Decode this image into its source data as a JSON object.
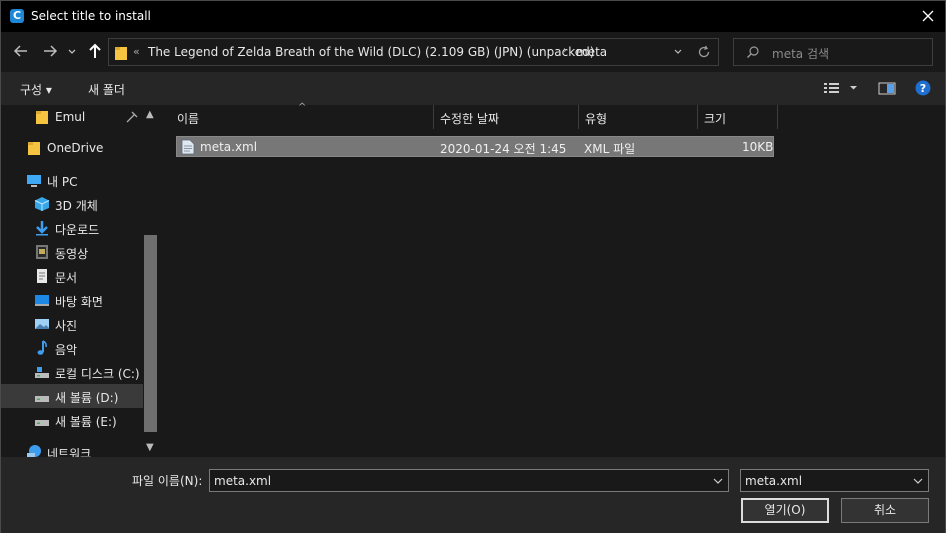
{
  "window": {
    "title": "Select title to install",
    "app_icon_letter": "C"
  },
  "nav": {
    "back_icon": "arrow-left-icon",
    "forward_icon": "arrow-right-icon",
    "recent_icon": "chevron-down-icon",
    "up_icon": "arrow-up-icon",
    "address": {
      "overflow": "«",
      "path": "The Legend of Zelda Breath of the Wild (DLC) (2.109 GB) (JPN) (unpacked)",
      "separator": "›",
      "current": "meta"
    },
    "search_placeholder": "meta 검색"
  },
  "toolbar": {
    "organize_label": "구성 ▾",
    "new_folder_label": "새 폴더",
    "help_label": "?"
  },
  "sidebar": {
    "items": [
      {
        "label": "Emul",
        "icon": "folder-icon"
      },
      {
        "label": "OneDrive",
        "icon": "folder-icon"
      },
      {
        "label": "내 PC",
        "icon": "computer-icon"
      },
      {
        "label": "3D 개체",
        "icon": "cube-icon"
      },
      {
        "label": "다운로드",
        "icon": "download-icon"
      },
      {
        "label": "동영상",
        "icon": "video-icon"
      },
      {
        "label": "문서",
        "icon": "document-icon"
      },
      {
        "label": "바탕 화면",
        "icon": "desktop-icon"
      },
      {
        "label": "사진",
        "icon": "picture-icon"
      },
      {
        "label": "음악",
        "icon": "music-icon"
      },
      {
        "label": "로컬 디스크 (C:)",
        "icon": "drive-icon"
      },
      {
        "label": "새 볼륨 (D:)",
        "icon": "drive-icon"
      },
      {
        "label": "새 볼륨 (E:)",
        "icon": "drive-icon"
      },
      {
        "label": "네트워크",
        "icon": "network-icon"
      }
    ]
  },
  "columns": [
    "이름",
    "수정한 날짜",
    "유형",
    "크기"
  ],
  "files": [
    {
      "name": "meta.xml",
      "modified": "2020-01-24 오전 1:45",
      "type": "XML 파일",
      "size": "10KB"
    }
  ],
  "bottom": {
    "filename_label": "파일 이름(N):",
    "filename_value": "meta.xml",
    "filetype_value": "meta.xml",
    "open_label": "열기(O)",
    "cancel_label": "취소"
  }
}
